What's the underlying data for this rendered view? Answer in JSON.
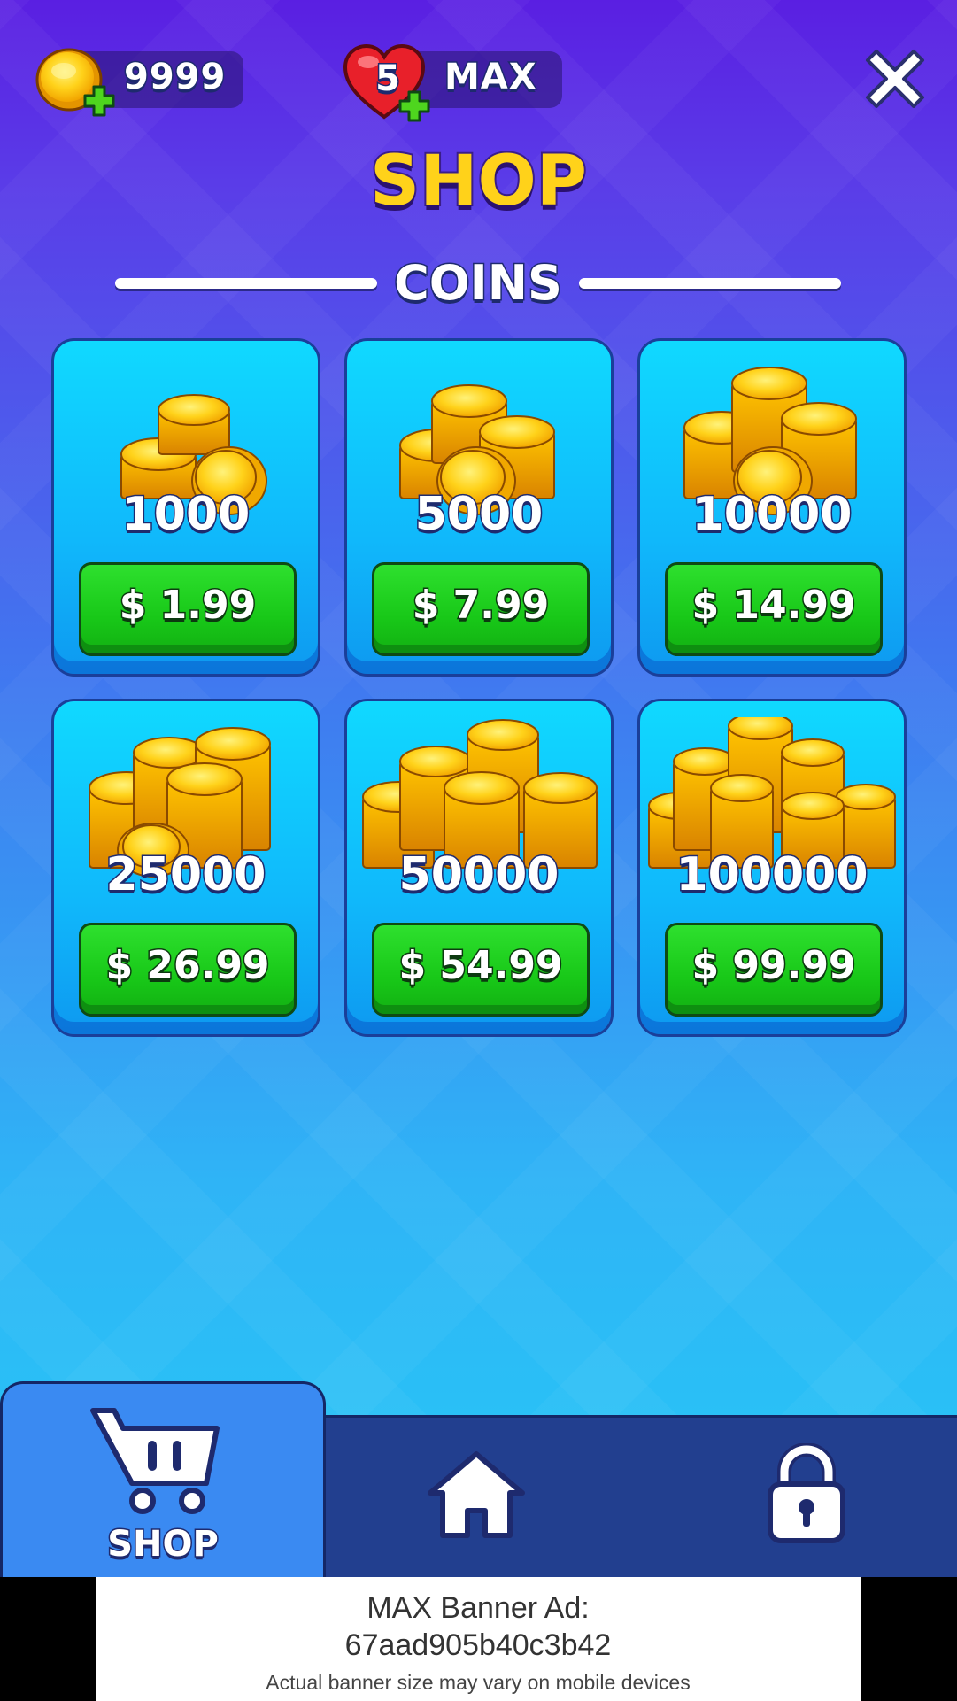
{
  "hud": {
    "coins_value": "9999",
    "lives_count": "5",
    "lives_value": "MAX",
    "coin_add_icon": "plus-icon",
    "heart_icon": "heart-icon",
    "close_icon": "close-icon"
  },
  "title": "SHOP",
  "section_label": "COINS",
  "packs": [
    {
      "amount": "1000",
      "price": "$ 1.99"
    },
    {
      "amount": "5000",
      "price": "$ 7.99"
    },
    {
      "amount": "10000",
      "price": "$ 14.99"
    },
    {
      "amount": "25000",
      "price": "$ 26.99"
    },
    {
      "amount": "50000",
      "price": "$ 54.99"
    },
    {
      "amount": "100000",
      "price": "$ 99.99"
    }
  ],
  "nav": {
    "shop_label": "SHOP",
    "shop_icon": "cart-icon",
    "home_icon": "home-icon",
    "lock_icon": "lock-icon"
  },
  "ad": {
    "title": "MAX Banner Ad:",
    "id": "67aad905b40c3b42",
    "note": "Actual banner size may vary on mobile devices"
  },
  "colors": {
    "coin_gold": "#ffd21a",
    "button_green": "#18c818",
    "card_blue": "#10b8fb",
    "nav_dark": "#223f8f",
    "nav_active": "#3a8af2"
  }
}
